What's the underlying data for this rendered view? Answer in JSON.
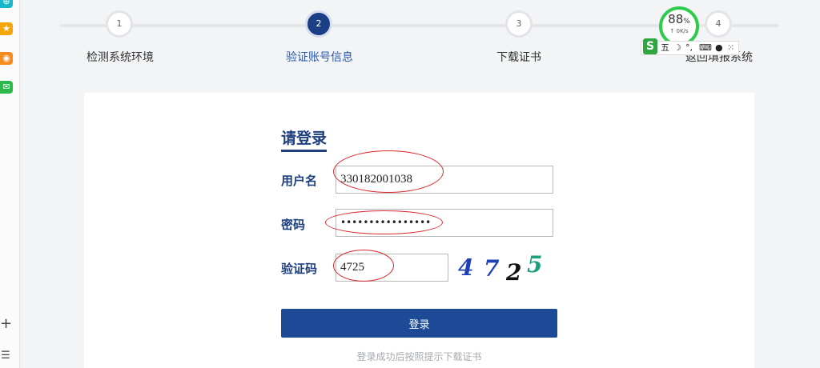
{
  "steps": [
    {
      "number": "1",
      "label": "检测系统环境"
    },
    {
      "number": "2",
      "label": "验证账号信息"
    },
    {
      "number": "3",
      "label": "下载证书"
    },
    {
      "number": "4",
      "label": "返回填报系统"
    }
  ],
  "speed_widget": {
    "percent": "88",
    "unit": "%",
    "rate": "↑ 0K/s",
    "color": "#2fcb4c"
  },
  "ime_toolbar": {
    "logo": "S",
    "mode": "五",
    "moon": "☽",
    "punct": "°,",
    "keyboard": "⌨",
    "user": "●",
    "grid": "⁙"
  },
  "dock": {
    "icons": [
      "globe-icon",
      "star-icon",
      "weibo-icon",
      "mail-icon"
    ],
    "plus": "+",
    "list": "☰"
  },
  "login": {
    "title": "请登录",
    "username_label": "用户名",
    "username_value": "330182001038",
    "password_label": "密码",
    "password_value": "••••••••••••••••",
    "captcha_label": "验证码",
    "captcha_value": "4725",
    "captcha_image": [
      "4",
      "7",
      "2",
      "5"
    ],
    "submit_label": "登录",
    "hint": "登录成功后按照提示下载证书"
  },
  "colors": {
    "primary": "#1d4a96",
    "annotation": "#d8262d",
    "captcha": [
      "#1f3fb8",
      "#1f3fb8",
      "#111111",
      "#1aa07a"
    ]
  }
}
